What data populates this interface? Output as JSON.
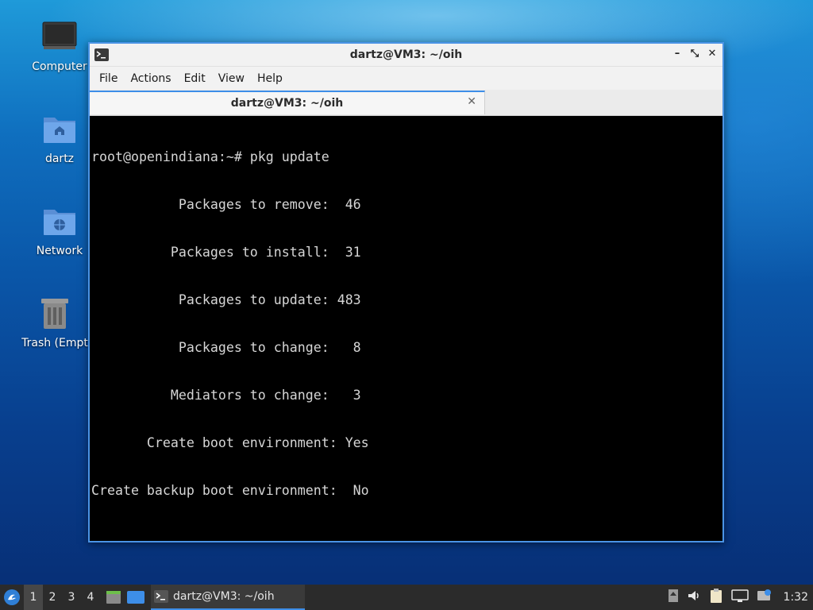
{
  "desktop": {
    "icons": [
      {
        "label": "Computer",
        "icon": "computer-icon"
      },
      {
        "label": "dartz",
        "icon": "home-folder-icon"
      },
      {
        "label": "Network",
        "icon": "network-folder-icon"
      },
      {
        "label": "Trash (Empt",
        "icon": "trash-icon"
      }
    ]
  },
  "window": {
    "title": "dartz@VM3: ~/oih",
    "menu": [
      "File",
      "Actions",
      "Edit",
      "View",
      "Help"
    ],
    "tab_title": "dartz@VM3: ~/oih",
    "terminal_lines": [
      "root@openindiana:~# pkg update",
      "           Packages to remove:  46",
      "          Packages to install:  31",
      "           Packages to update: 483",
      "           Packages to change:   8",
      "          Mediators to change:   3",
      "       Create boot environment: Yes",
      "Create backup boot environment:  No",
      ""
    ]
  },
  "taskbar": {
    "workspaces": [
      "1",
      "2",
      "3",
      "4"
    ],
    "active_workspace": "1",
    "task_label": "dartz@VM3: ~/oih",
    "clock": "1:32"
  },
  "colors": {
    "accent": "#3d8ee8",
    "terminal_bg": "#000000",
    "terminal_fg": "#d6d6d6",
    "taskbar_bg": "#2b2b2b"
  }
}
